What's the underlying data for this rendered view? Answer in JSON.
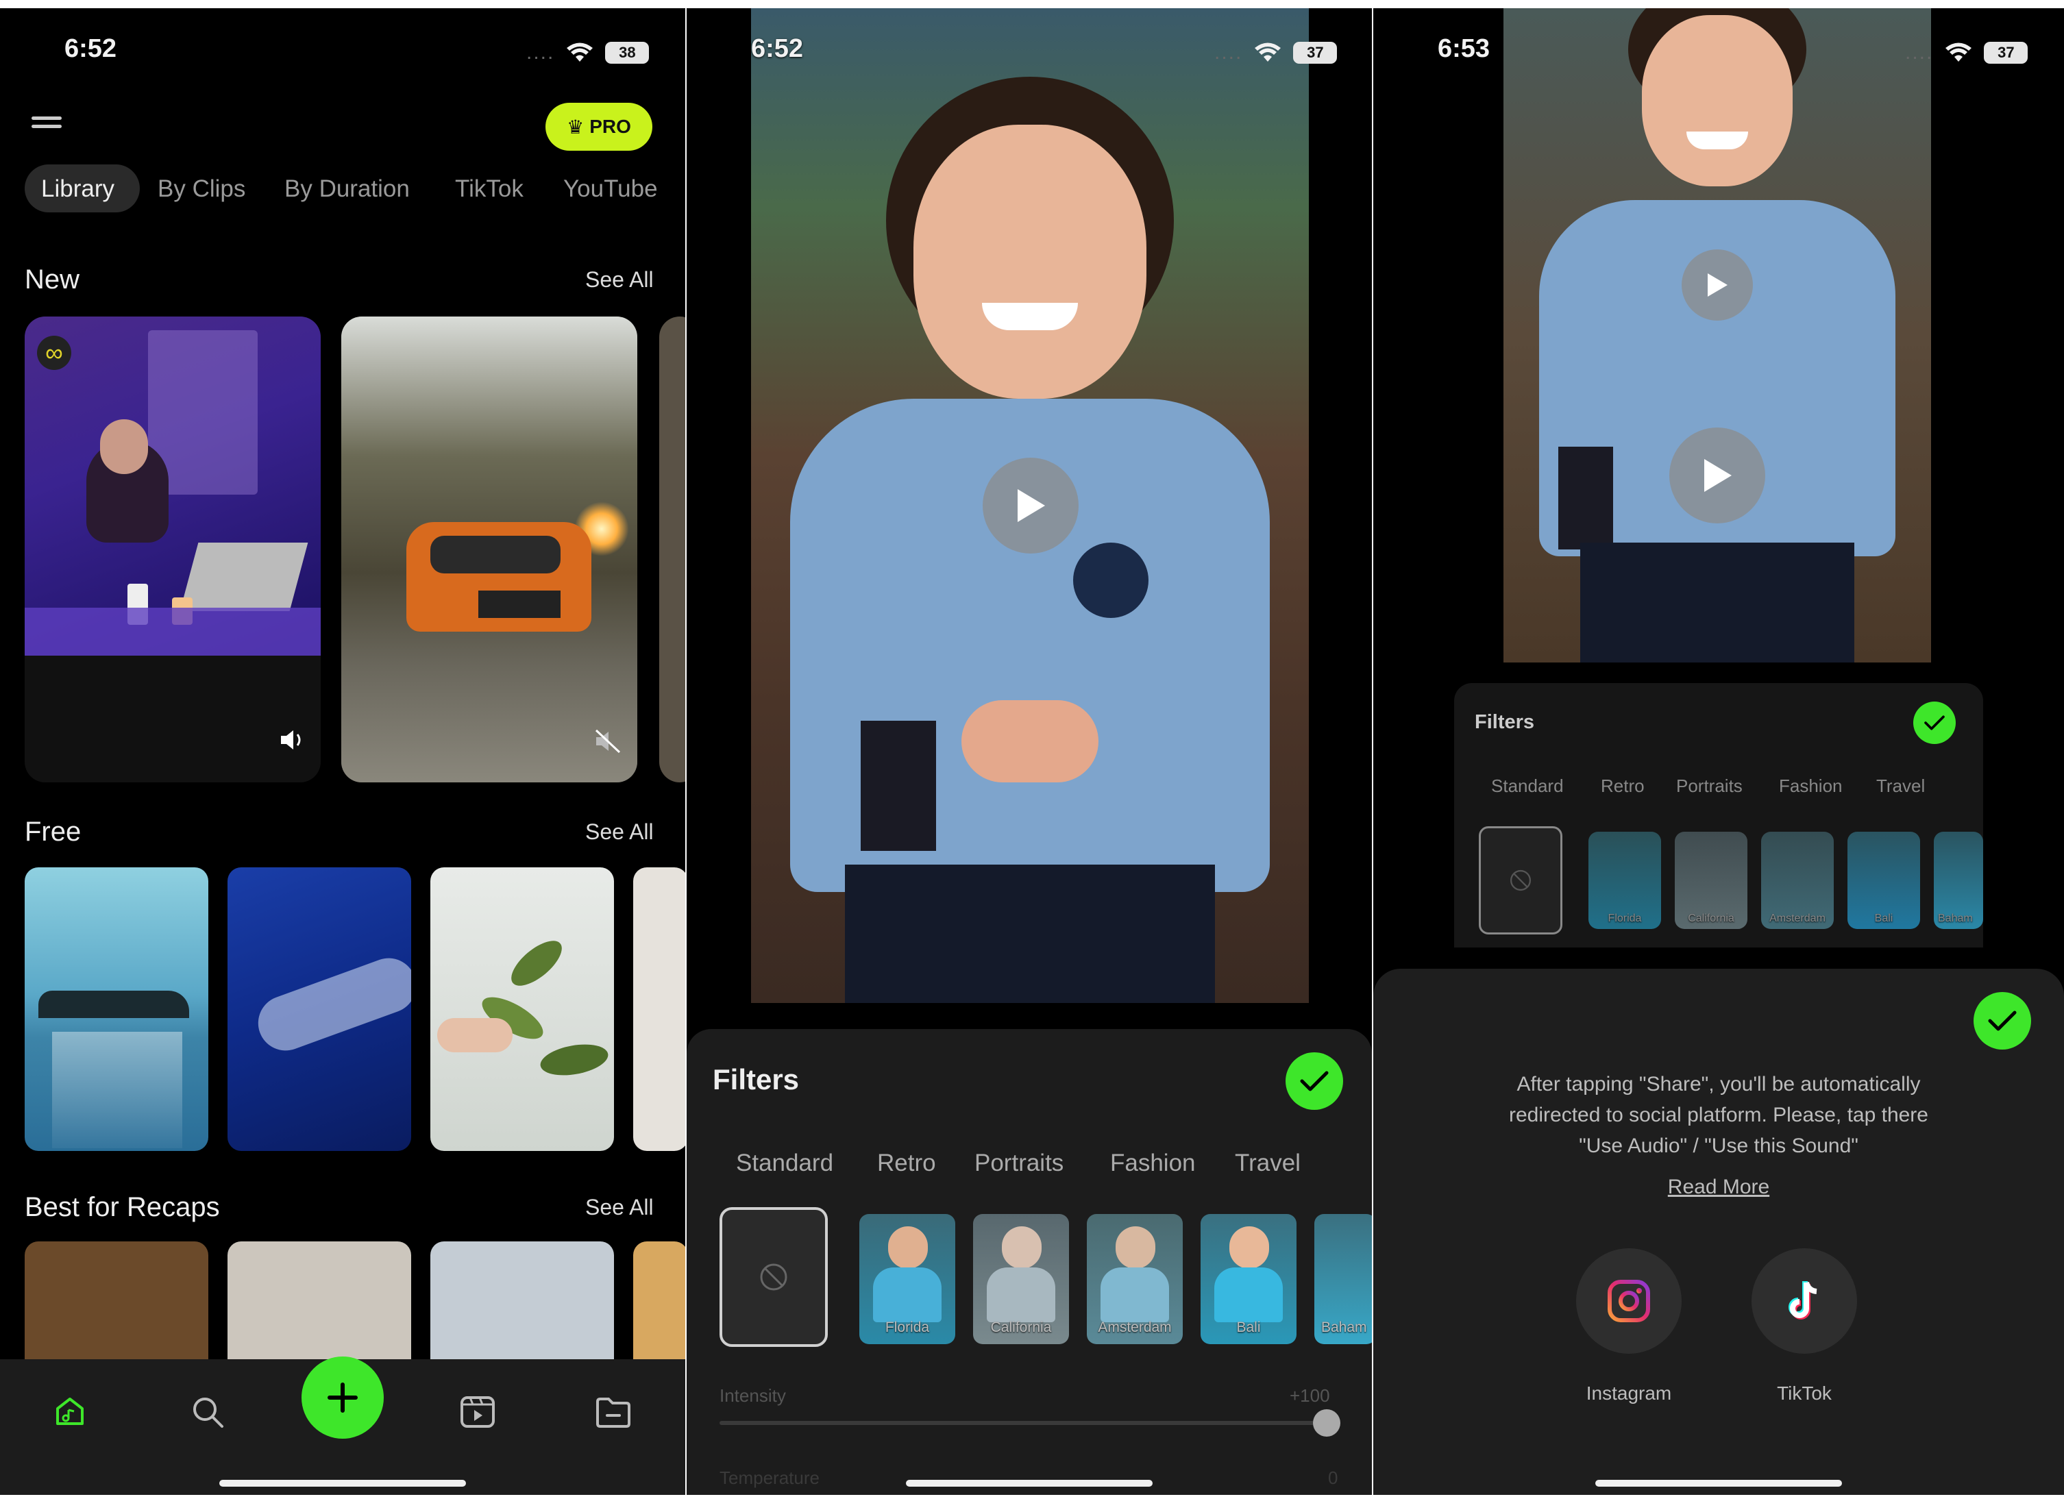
{
  "screen1": {
    "time": "6:52",
    "battery": "38",
    "pro_label": "PRO",
    "tabs": [
      "Library",
      "By Clips",
      "By Duration",
      "TikTok",
      "YouTube"
    ],
    "sections": [
      {
        "title": "New",
        "see_all": "See All"
      },
      {
        "title": "Free",
        "see_all": "See All"
      },
      {
        "title": "Best for Recaps",
        "see_all": "See All"
      }
    ],
    "infinity": "∞"
  },
  "screen2": {
    "time": "6:52",
    "battery": "37",
    "filters_title": "Filters",
    "filter_tabs": [
      "Standard",
      "Retro",
      "Portraits",
      "Fashion",
      "Travel"
    ],
    "presets": [
      "Florida",
      "California",
      "Amsterdam",
      "Bali",
      "Baham"
    ],
    "intensity_label": "Intensity",
    "intensity_value": "+100",
    "next_label": "Temperature",
    "next_value": "0"
  },
  "screen3": {
    "time": "6:53",
    "battery": "37",
    "filters_title": "Filters",
    "filter_tabs": [
      "Standard",
      "Retro",
      "Portraits",
      "Fashion",
      "Travel"
    ],
    "presets": [
      "Florida",
      "California",
      "Amsterdam",
      "Bali",
      "Baham"
    ],
    "share_text_1": "After tapping \"Share\", you'll be automatically",
    "share_text_2": "redirected to social platform. Please, tap there",
    "share_text_3": "\"Use Audio\" / \"Use this Sound\"",
    "read_more": "Read More",
    "instagram": "Instagram",
    "tiktok": "TikTok"
  },
  "colors": {
    "accent": "#3ee62a",
    "pro": "#c9f21c"
  }
}
